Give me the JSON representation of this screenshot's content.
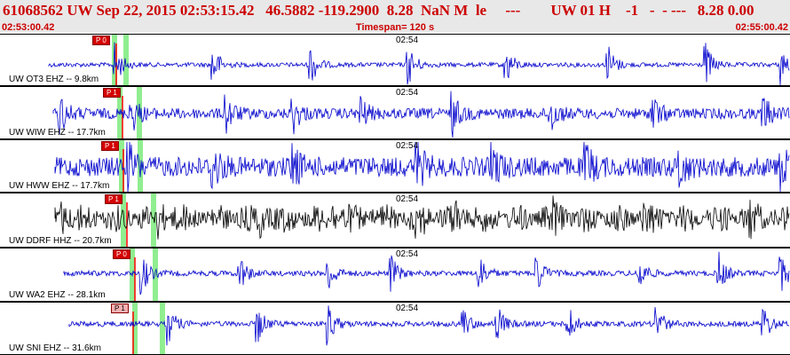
{
  "header": {
    "event_line": "61068562 UW Sep 22, 2015 02:53:15.42   46.5882 -119.2900  8.28  NaN M  le     ---        UW 01 H    -1   -  - ---   8.28 0.00",
    "time_left": "02:53:00.42",
    "timespan": "Timespan= 120 s",
    "time_right": "02:55:00.42"
  },
  "colors": {
    "header_text": "#cc0000",
    "trace_blue": "#0000cc",
    "trace_black": "#000000",
    "pick_red": "#ff0000",
    "pick_window_green": "#90ee90"
  },
  "minute_label": "02:54",
  "traces": [
    {
      "label": "UW OT3 EHZ -- 9.8km",
      "pick": "P 0",
      "color": "blue"
    },
    {
      "label": "UW WIW EHZ -- 17.7km",
      "pick": "P 1",
      "color": "blue"
    },
    {
      "label": "UW HWW EHZ -- 17.7km",
      "pick": "P 1",
      "color": "blue"
    },
    {
      "label": "UW DDRF HHZ -- 20.7km",
      "pick": "P 1",
      "color": "black"
    },
    {
      "label": "UW WA2 EHZ -- 28.1km",
      "pick": "P 0",
      "color": "blue"
    },
    {
      "label": "UW SNI EHZ -- 31.6km",
      "pick": "P 1",
      "color": "blue"
    }
  ]
}
